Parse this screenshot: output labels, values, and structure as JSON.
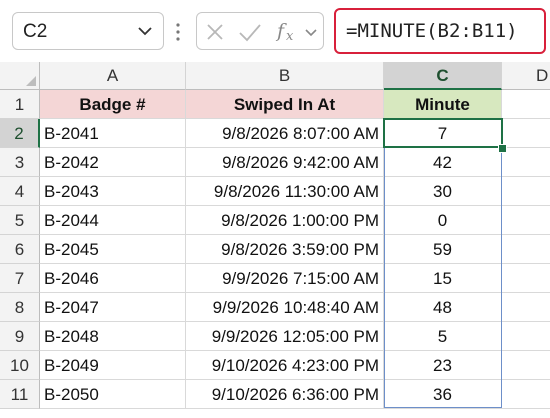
{
  "name_box": {
    "value": "C2"
  },
  "formula_bar": {
    "value": "=MINUTE(B2:B11)",
    "accent_color": "#d8203b"
  },
  "icons": {
    "namebox_dropdown": "chevron-down-icon",
    "more": "vertical-dots-icon",
    "cancel": "x-icon",
    "enter": "check-icon",
    "function": "fx-icon",
    "fx_dropdown": "chevron-down-icon"
  },
  "columns": [
    "A",
    "B",
    "C",
    "D"
  ],
  "headers": [
    "Badge #",
    "Swiped In At",
    "Minute"
  ],
  "header_colors": {
    "a": "#f4d6d6",
    "b": "#f4d6d6",
    "c": "#d7e8bf"
  },
  "rows": [
    {
      "num": "1"
    },
    {
      "num": "2",
      "badge": "B-2041",
      "swiped": "9/8/2026 8:07:00 AM",
      "minute": "7"
    },
    {
      "num": "3",
      "badge": "B-2042",
      "swiped": "9/8/2026 9:42:00 AM",
      "minute": "42"
    },
    {
      "num": "4",
      "badge": "B-2043",
      "swiped": "9/8/2026 11:30:00 AM",
      "minute": "30"
    },
    {
      "num": "5",
      "badge": "B-2044",
      "swiped": "9/8/2026 1:00:00 PM",
      "minute": "0"
    },
    {
      "num": "6",
      "badge": "B-2045",
      "swiped": "9/8/2026 3:59:00 PM",
      "minute": "59"
    },
    {
      "num": "7",
      "badge": "B-2046",
      "swiped": "9/9/2026 7:15:00 AM",
      "minute": "15"
    },
    {
      "num": "8",
      "badge": "B-2047",
      "swiped": "9/9/2026 10:48:40 AM",
      "minute": "48"
    },
    {
      "num": "9",
      "badge": "B-2048",
      "swiped": "9/9/2026 12:05:00 PM",
      "minute": "5"
    },
    {
      "num": "10",
      "badge": "B-2049",
      "swiped": "9/10/2026 4:23:00 PM",
      "minute": "23"
    },
    {
      "num": "11",
      "badge": "B-2050",
      "swiped": "9/10/2026 6:36:00 PM",
      "minute": "36"
    }
  ],
  "active_cell": "C2",
  "selection_range": "C2:C11"
}
